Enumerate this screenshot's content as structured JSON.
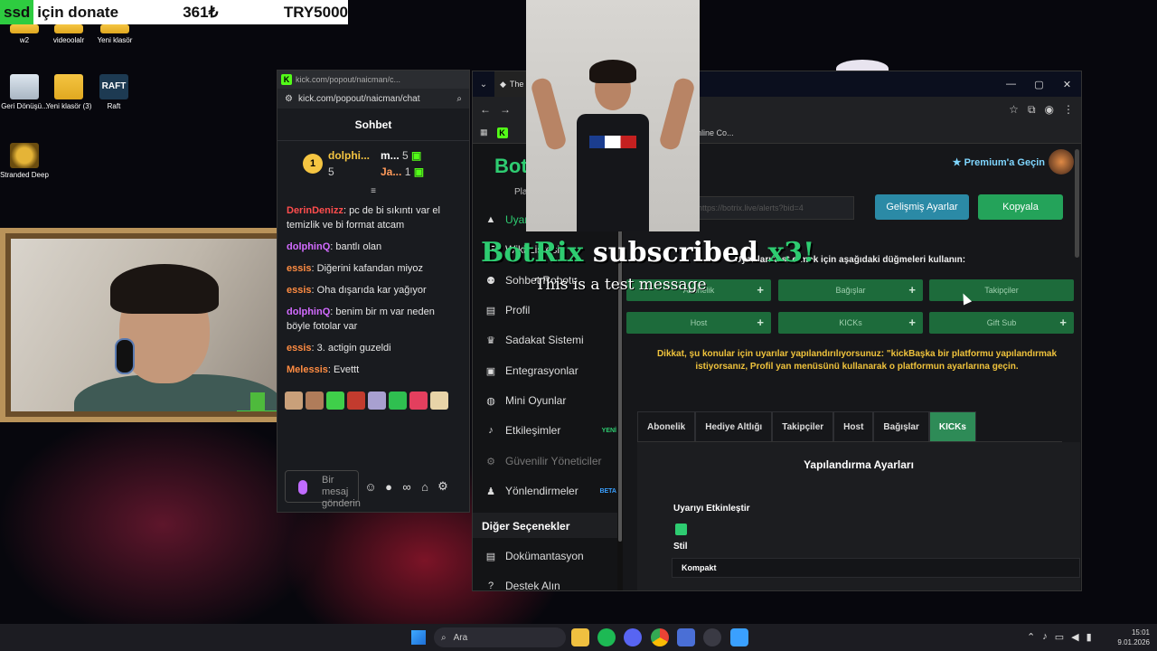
{
  "donation": {
    "user": "ssd",
    "text": "için donate",
    "amount": "361₺",
    "total": "TRY5000"
  },
  "desktop_icons": [
    {
      "label": "w2"
    },
    {
      "label": "videoolalr"
    },
    {
      "label": "Yeni klasör"
    },
    {
      "label": "Geri Dönüşü..."
    },
    {
      "label": "Yeni klasör (3)"
    },
    {
      "label": "Raft"
    },
    {
      "label": "Stranded Deep"
    }
  ],
  "chat": {
    "window_title": "kick.com/popout/naicman/c...",
    "url": "kick.com/popout/naicman/chat",
    "header": "Sohbet",
    "leaderboard": [
      {
        "name": "dolphi...",
        "count": "5",
        "rank": "1"
      },
      {
        "name": "m...",
        "count": "5"
      },
      {
        "name": "Ja...",
        "count": "1"
      }
    ],
    "messages": [
      {
        "user": "DerinDenizz",
        "text": "pc de bi sıkıntı var el temizlik ve bi format atcam"
      },
      {
        "user": "dolphinQ",
        "text": "bantlı olan"
      },
      {
        "user": "essis",
        "text": "Diğerini kafandan miyoz"
      },
      {
        "user": "essis",
        "text": "Oha dışarıda kar yağıyor"
      },
      {
        "user": "dolphinQ",
        "text": "benim bir m var neden böyle fotolar var"
      },
      {
        "user": "essis",
        "text": "3. actigin guzeldi"
      },
      {
        "user": "Melessis",
        "text": "Evettt"
      }
    ],
    "input_placeholder": "Bir mesaj gönderin"
  },
  "browser": {
    "tab_title": "The",
    "bookmark": "CodePen: Online Co...",
    "brand": "Bot",
    "sidebar_sub": "Pla",
    "sidebar": [
      {
        "label": "Uyarı"
      },
      {
        "label": "Wiki Listesi"
      },
      {
        "label": "Sohbet Robotu"
      },
      {
        "label": "Profil"
      },
      {
        "label": "Sadakat Sistemi"
      },
      {
        "label": "Entegrasyonlar"
      },
      {
        "label": "Mini Oyunlar"
      },
      {
        "label": "Etkileşimler",
        "badge": "YENİ"
      },
      {
        "label": "Güvenilir Yöneticiler"
      },
      {
        "label": "Yönlendirmeler",
        "badge": "BETA"
      }
    ],
    "sidebar_section": "Diğer Seçenekler",
    "sidebar_bottom": [
      {
        "label": "Dokümantasyon"
      },
      {
        "label": "Destek Alın"
      }
    ],
    "premium": "Premium'a Geçin",
    "url_blurred": "https://botrix.live/alerts?bid=4",
    "advanced_btn": "Gelişmiş Ayarlar",
    "copy_btn": "Kopyala",
    "test_instruction": "Uyarıları test etmek için aşağıdaki düğmeleri kullanın:",
    "test_buttons": [
      "Abonelik",
      "Bağışlar",
      "Takipçiler",
      "Host",
      "KICKs",
      "Gift Sub"
    ],
    "warning": "Dikkat, şu konular için uyarılar yapılandırılıyorsunuz: \"kickBaşka bir platformu yapılandırmak istiyorsanız, Profil yan menüsünü kullanarak o platformun ayarlarına geçin.",
    "tabs": [
      "Abonelik",
      "Hediye Altlığı",
      "Takipçiler",
      "Host",
      "Bağışlar",
      "KICKs"
    ],
    "active_tab": "KICKs",
    "config_title": "Yapılandırma Ayarları",
    "enable_label": "Uyarıyı Etkinleştir",
    "style_label": "Stil",
    "style_value": "Kompakt"
  },
  "overlay": {
    "alert_bot": "BotRix",
    "alert_text": "subscribed",
    "alert_mult": "x3!",
    "alert_message": "This is a test message"
  },
  "taskbar": {
    "search": "Ara",
    "time": "15:01",
    "date": "9.01.2026"
  }
}
